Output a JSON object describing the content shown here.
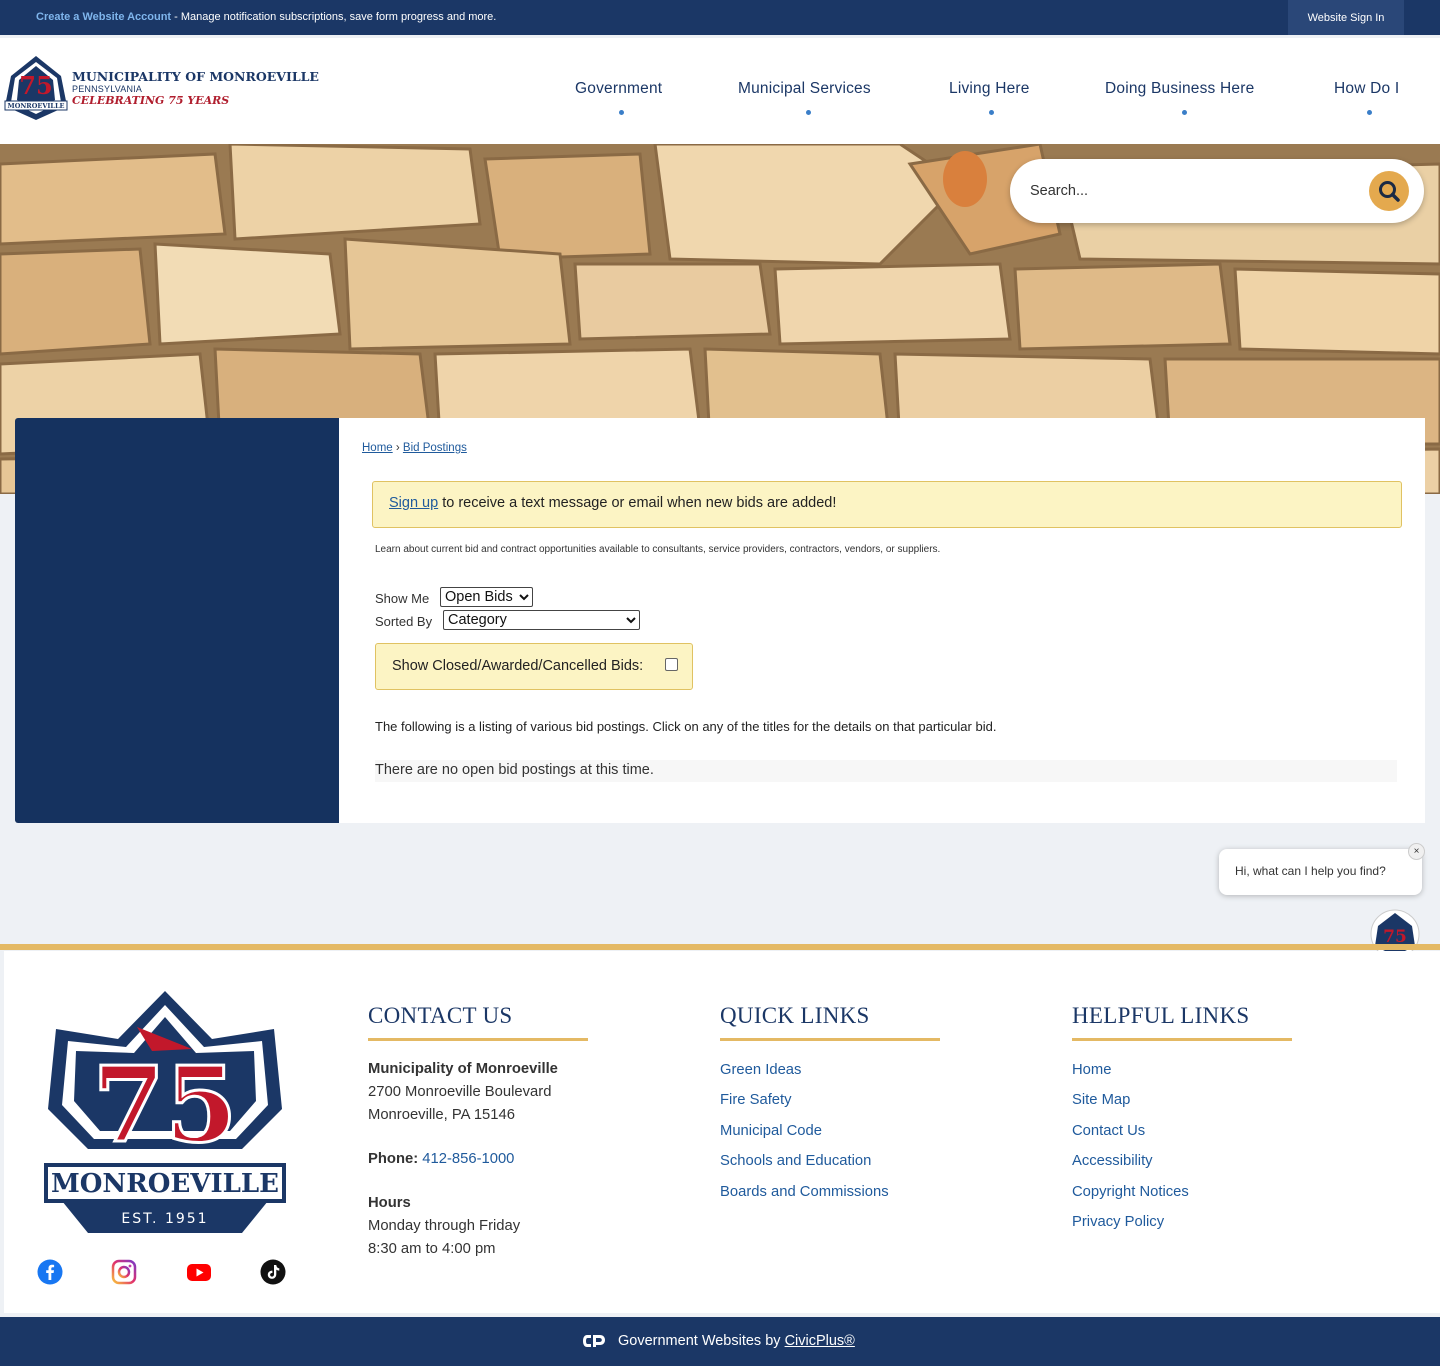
{
  "topbar": {
    "create_link": "Create a Website Account",
    "message": " - Manage notification subscriptions, save form progress and more.",
    "signin": "Website Sign In"
  },
  "logo": {
    "line1": "MUNICIPALITY OF MONROEVILLE",
    "line2": "PENNSYLVANIA",
    "line3": "CELEBRATING 75 YEARS",
    "emblem_text": "MONROEVILLE"
  },
  "nav": {
    "items": [
      "Government",
      "Municipal Services",
      "Living Here",
      "Doing Business Here",
      "How Do I"
    ]
  },
  "search": {
    "placeholder": "Search..."
  },
  "breadcrumb": {
    "home": "Home",
    "sep": " › ",
    "current": "Bid Postings"
  },
  "alert": {
    "link": "Sign up",
    "text": " to receive a text message or email when new bids are added!"
  },
  "intro": "Learn about current bid and contract opportunities available to consultants, service providers, contractors, vendors, or suppliers.",
  "filters": {
    "show_me_label": "Show Me",
    "show_me_value": "Open Bids",
    "sorted_by_label": "Sorted By",
    "sorted_by_value": "Category",
    "closed_label": "Show Closed/Awarded/Cancelled Bids:"
  },
  "listing_text": "The following is a listing of various bid postings. Click on any of the titles for the details on that particular bid.",
  "no_bids": "There are no open bid postings at this time.",
  "chat": {
    "text": "Hi, what can I help you find?",
    "close": "×"
  },
  "footer": {
    "logo_text": "MONROEVILLE",
    "logo_est": "EST. 1951",
    "contact": {
      "title": "CONTACT US",
      "org": "Municipality of Monroeville",
      "address1": "2700 Monroeville Boulevard",
      "address2": "Monroeville, PA 15146",
      "phone_label": "Phone: ",
      "phone": "412-856-1000",
      "hours_label": "Hours",
      "hours1": "Monday through Friday",
      "hours2": "8:30 am to 4:00 pm"
    },
    "quick": {
      "title": "QUICK LINKS",
      "links": [
        "Green Ideas",
        "Fire Safety",
        "Municipal Code",
        "Schools and Education",
        "Boards and Commissions"
      ]
    },
    "helpful": {
      "title": "HELPFUL LINKS",
      "links": [
        "Home",
        "Site Map",
        "Contact Us",
        "Accessibility",
        "Copyright Notices",
        "Privacy Policy"
      ]
    }
  },
  "bottombar": {
    "prefix": "Government Websites by ",
    "link": "CivicPlus®"
  },
  "colors": {
    "navy": "#1b3766",
    "gold": "#e4b964",
    "link": "#1f5a9c",
    "alert_bg": "#fcf4c4"
  }
}
